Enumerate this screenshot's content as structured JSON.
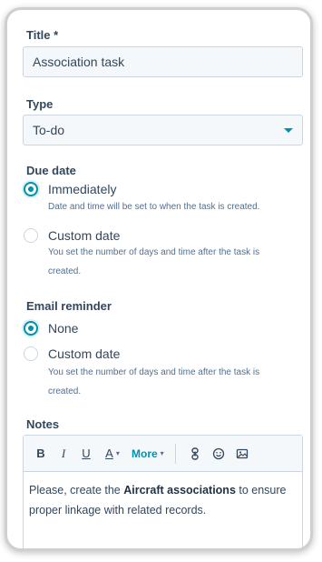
{
  "title_field": {
    "label": "Title *",
    "value": "Association task"
  },
  "type_field": {
    "label": "Type",
    "value": "To-do"
  },
  "due_date": {
    "label": "Due date",
    "options": [
      {
        "label": "Immediately",
        "help": "Date and time will be set to when the task is created.",
        "checked": true
      },
      {
        "label": "Custom date",
        "help": "You set the number of days and time after the task is created.",
        "checked": false
      }
    ]
  },
  "email_reminder": {
    "label": "Email reminder",
    "options": [
      {
        "label": "None",
        "checked": true
      },
      {
        "label": "Custom date",
        "help": "You set the number of days and time after the task is created.",
        "checked": false
      }
    ]
  },
  "notes": {
    "label": "Notes",
    "toolbar": {
      "bold": "B",
      "italic": "I",
      "underline": "U",
      "text_color": "A",
      "more": "More",
      "icons": [
        "link-icon",
        "emoji-icon",
        "image-icon"
      ]
    },
    "content": {
      "before": "Please, create the ",
      "bold": "Aircraft associations",
      "after": " to ensure proper linkage with related records."
    }
  },
  "colors": {
    "accent": "#0091ae",
    "text": "#33475b",
    "border": "#cbd6e2",
    "input_bg": "#f5f8fa"
  }
}
